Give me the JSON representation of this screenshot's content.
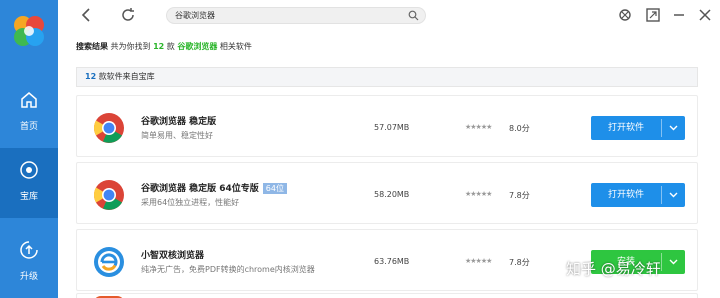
{
  "sidebar": {
    "items": [
      {
        "label": "首页"
      },
      {
        "label": "宝库"
      },
      {
        "label": "升级"
      }
    ]
  },
  "search": {
    "value": "谷歌浏览器"
  },
  "results": {
    "label": "搜索结果",
    "prefix": "共为你找到",
    "count": "12",
    "unit": "款",
    "keyword": "谷歌浏览器",
    "suffix": "相关软件"
  },
  "count_bar": {
    "num": "12",
    "text": "款软件来自宝库"
  },
  "apps": [
    {
      "name": "谷歌浏览器 稳定版",
      "tag": "",
      "desc": "简单易用、稳定性好",
      "size": "57.07MB",
      "stars": "★★★★★",
      "score": "8.0分",
      "button": "打开软件",
      "icon": "chrome-icon"
    },
    {
      "name": "谷歌浏览器 稳定版 64位专版",
      "tag": "64位",
      "desc": "采用64位独立进程，性能好",
      "size": "58.20MB",
      "stars": "★★★★★",
      "score": "7.8分",
      "button": "打开软件",
      "icon": "chrome-icon"
    },
    {
      "name": "小智双核浏览器",
      "tag": "",
      "desc": "纯净无广告，免费PDF转换的chrome内核浏览器",
      "size": "63.76MB",
      "stars": "★★★★★",
      "score": "7.8分",
      "button": "安装",
      "icon": "e-browser-icon"
    }
  ],
  "watermark": "知乎 @易冷轩",
  "colors": {
    "sidebar": "#2d86d9",
    "accent": "#1e8fe9",
    "install": "#2ec640",
    "keyword": "#2bb52b"
  }
}
